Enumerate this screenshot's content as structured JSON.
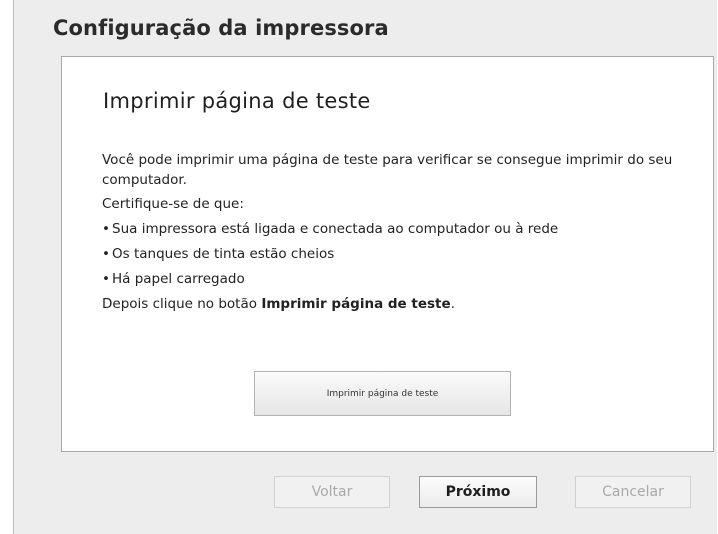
{
  "window": {
    "title": "Configuração da impressora"
  },
  "panel": {
    "title": "Imprimir página de teste",
    "intro": "Você pode imprimir uma página de teste para verificar se consegue imprimir do seu computador.",
    "checklist_heading": "Certifique-se de que:",
    "bullet_symbol": "•",
    "checklist": [
      "Sua impressora está ligada e conectada ao computador ou à rede",
      "Os tanques de tinta estão cheios",
      "Há papel carregado"
    ],
    "instruction_prefix": "Depois clique no botão ",
    "instruction_button_ref": "Imprimir página de teste",
    "instruction_suffix": ".",
    "print_test_button_label": "Imprimir página de teste"
  },
  "footer": {
    "back_label": "Voltar",
    "next_label": "Próximo",
    "cancel_label": "Cancelar"
  }
}
